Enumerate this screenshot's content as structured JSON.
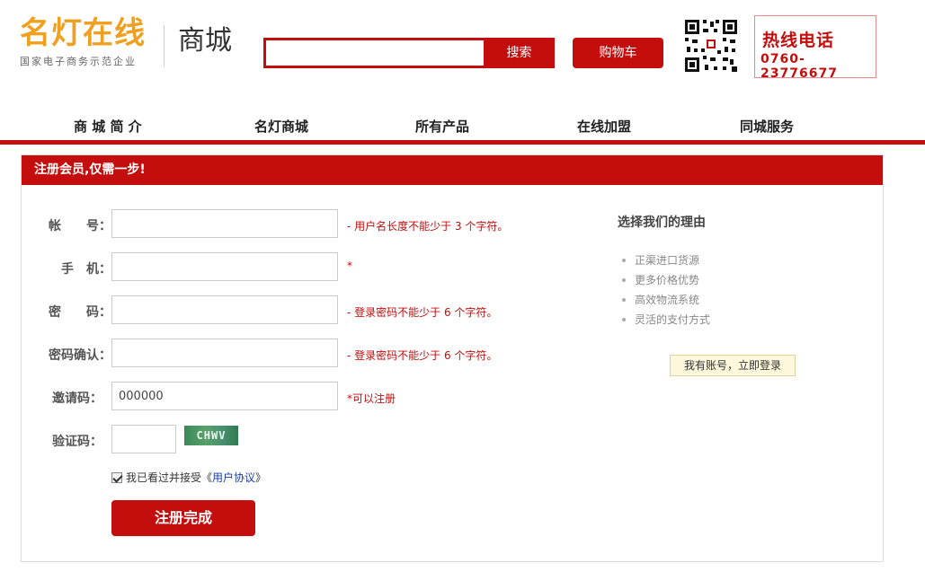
{
  "header": {
    "logo_main": "名灯在线",
    "logo_sub": "国家电子商务示范企业",
    "logo_shop": "商城",
    "search_value": "",
    "search_label": "搜索",
    "cart_label": "购物车",
    "hotline_title": "热线电话",
    "hotline_number": "0760-23776677"
  },
  "nav": {
    "items": [
      "商 城 简 介",
      "名灯商城",
      "所有产品",
      "在线加盟",
      "同城服务"
    ]
  },
  "panel": {
    "title": "注册会员,仅需一步!"
  },
  "form": {
    "account_label": "帐　　号：",
    "account_hint": "- 用户名长度不能少于 3 个字符。",
    "phone_label": "手　机：",
    "phone_hint": "*",
    "password_label": "密　　码：",
    "password_hint": "- 登录密码不能少于 6 个字符。",
    "confirm_label": "密码确认：",
    "confirm_hint": "- 登录密码不能少于 6 个字符。",
    "invite_label": "邀请码：",
    "invite_value": "000000",
    "invite_hint": "*可以注册",
    "captcha_label": "验证码：",
    "captcha_text": "CHWV",
    "agree_text": "我已看过并接受《",
    "agree_link": "用户协议",
    "agree_end": "》",
    "submit_label": "注册完成"
  },
  "side": {
    "reason_title": "选择我们的理由",
    "reasons": [
      "正渠进口货源",
      "更多价格优势",
      "高效物流系统",
      "灵活的支付方式"
    ],
    "login_label": "我有账号，立即登录"
  },
  "colors": {
    "brand_red": "#c40d0d",
    "logo_orange": "#f0a020"
  }
}
